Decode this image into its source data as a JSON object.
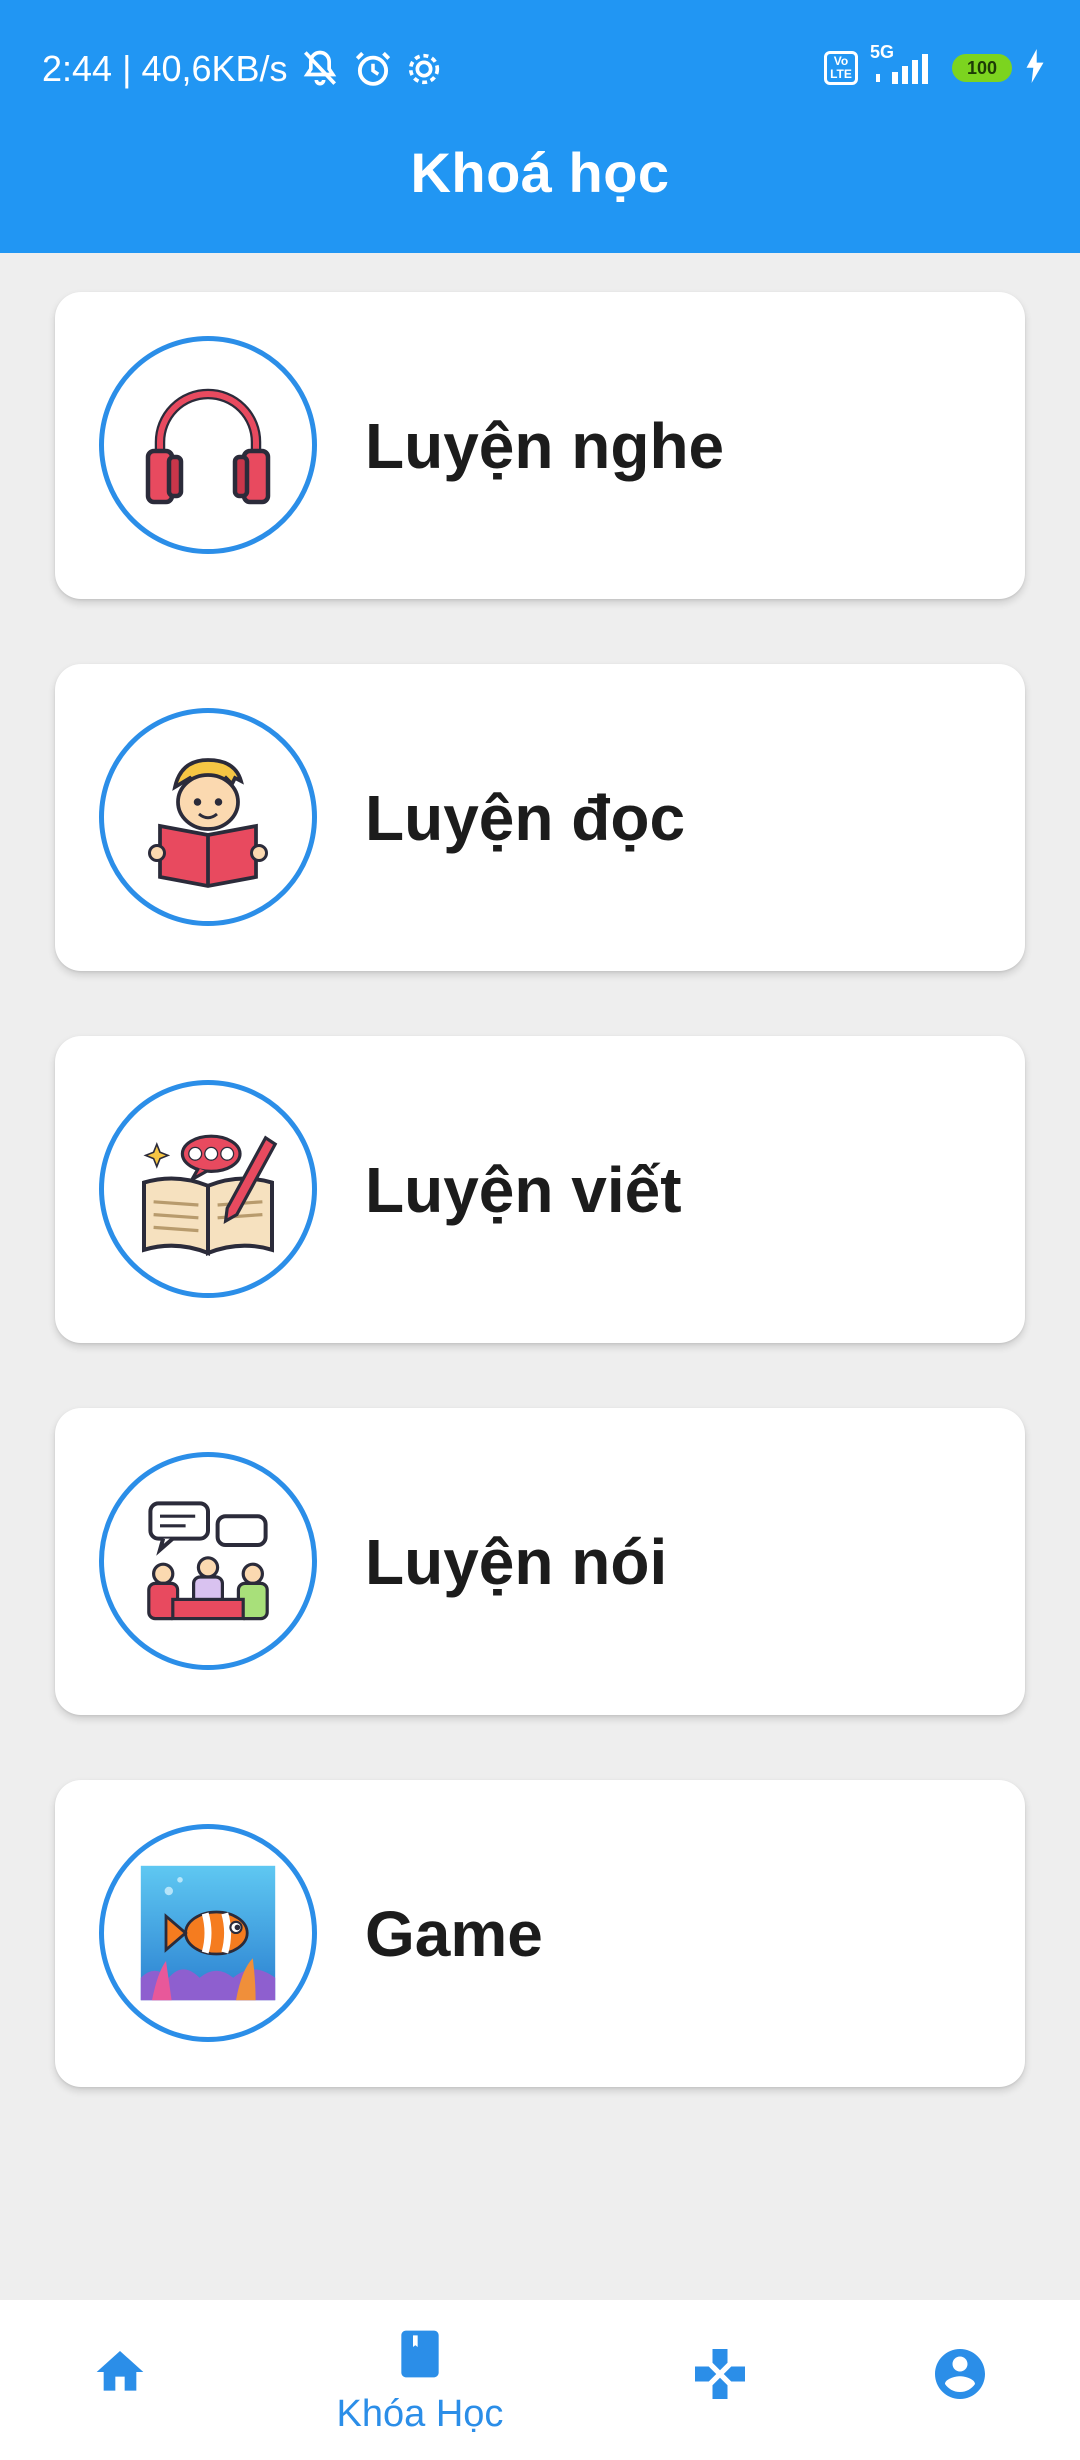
{
  "status_bar": {
    "time": "2:44",
    "network_speed": "40,6KB/s",
    "volte": [
      "Vo",
      "LTE"
    ],
    "network_type": "5G",
    "battery": "100",
    "icons": [
      "muted-bell-icon",
      "alarm-icon",
      "settings-gear-icon",
      "volte-icon",
      "signal-icon",
      "battery-icon",
      "charging-icon"
    ]
  },
  "header": {
    "title": "Khoá học"
  },
  "courses": [
    {
      "label": "Luyện nghe",
      "icon": "headphones-icon"
    },
    {
      "label": "Luyện đọc",
      "icon": "reading-boy-icon"
    },
    {
      "label": "Luyện viết",
      "icon": "writing-book-icon"
    },
    {
      "label": "Luyện nói",
      "icon": "speaking-group-icon"
    },
    {
      "label": "Game",
      "icon": "fish-game-icon"
    }
  ],
  "bottom_nav": {
    "items": [
      {
        "name": "home",
        "icon": "home-icon",
        "label": ""
      },
      {
        "name": "courses",
        "icon": "book-icon",
        "label": "Khóa Học",
        "active": true
      },
      {
        "name": "games",
        "icon": "gamepad-icon",
        "label": ""
      },
      {
        "name": "profile",
        "icon": "account-circle-icon",
        "label": ""
      }
    ],
    "accent": "#2b8ee8"
  },
  "colors": {
    "app_bar": "#2196f3",
    "background": "#eeeeee",
    "card": "#ffffff",
    "ring": "#2b8ee8"
  }
}
